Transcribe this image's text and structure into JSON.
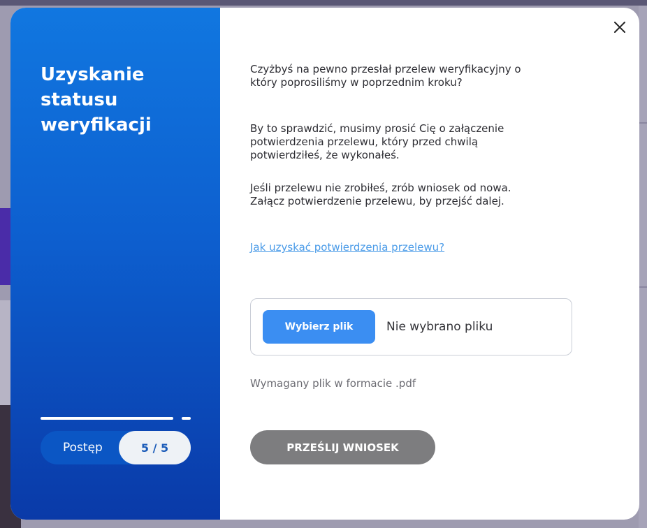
{
  "modal": {
    "side": {
      "title": "Uzyskanie statusu weryfikacji",
      "progress": {
        "label": "Postęp",
        "count": "5 / 5",
        "fraction": 0.93
      }
    },
    "content": {
      "paragraphs": [
        "Czyżbyś na pewno przesłał przelew weryfikacyjny o który poprosiliśmy w poprzednim kroku?",
        "By to sprawdzić, musimy prosić Cię o załączenie potwierdzenia przelewu, który przed chwilą potwierdziłeś, że wykonałeś.",
        "Jeśli przelewu nie zrobiłeś, zrób wniosek od nowa. Załącz potwierdzenie przelewu, by przejść dalej."
      ],
      "help_link": "Jak uzyskać potwierdzenia przelewu?",
      "file_input": {
        "button_label": "Wybierz plik",
        "status": "Nie wybrano pliku"
      },
      "file_hint": "Wymagany plik w formacie .pdf",
      "submit_label": "PRZEŚLIJ WNIOSEK"
    },
    "close_icon": "close-icon"
  },
  "colors": {
    "accent_blue": "#3b8ef2",
    "side_gradient_top": "#1177e0",
    "side_gradient_bottom": "#0a3aa8",
    "link": "#4a9be8",
    "submit_disabled": "#7d7d7f"
  }
}
